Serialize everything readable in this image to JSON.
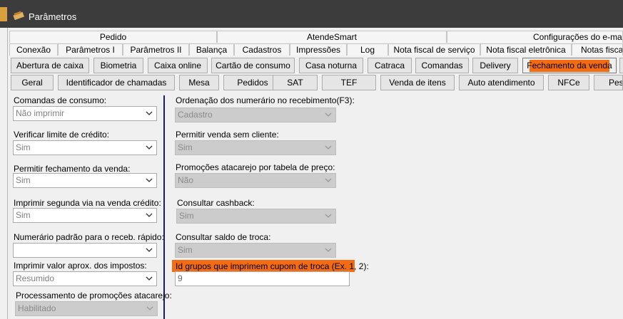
{
  "window": {
    "title": "Parâmetros"
  },
  "tabs_row1": [
    "Pedido",
    "AtendeSmart",
    "Configurações do e-mail"
  ],
  "tabs_row2": [
    "Conexão",
    "Parâmetros I",
    "Parâmetros II",
    "Balança",
    "Cadastros",
    "Impressões",
    "Log",
    "Nota fiscal de serviço",
    "Nota fiscal eletrônica",
    "Notas fiscais"
  ],
  "tabs_row3": [
    "Abertura de caixa",
    "Biometria",
    "Caixa online",
    "Cartão de consumo",
    "Casa noturna",
    "Catraca",
    "Comandas",
    "Delivery",
    "Fechamento da venda"
  ],
  "tabs_row4": [
    "Geral",
    "Identificador de chamadas",
    "Mesa",
    "Pedidos",
    "SAT",
    "TEF",
    "Venda de itens",
    "Auto atendimento",
    "NFCe",
    "Peso"
  ],
  "active_tab": "Fechamento da venda",
  "left": {
    "comandas_label": "Comandas de consumo:",
    "comandas_value": "Não imprimir",
    "limite_label": "Verificar limite de crédito:",
    "limite_value": "Sim",
    "fechamento_label": "Permitir fechamento da venda:",
    "fechamento_value": "Sim",
    "segunda_via_label": "Imprimir segunda via na venda crédito:",
    "segunda_via_value": "Sim",
    "numerario_label": "Numerário padrão para o receb. rápido:",
    "numerario_value": "",
    "impostos_label": "Imprimir valor aprox. dos impostos:",
    "impostos_value": "Resumido",
    "promocoes_label": "Processamento de promoções atacarejo:",
    "promocoes_value": "Habilitado"
  },
  "right": {
    "ordenacao_label": "Ordenação dos numerário no recebimento(F3):",
    "ordenacao_value": "Cadastro",
    "sem_cliente_label": "Permitir venda sem cliente:",
    "sem_cliente_value": "Sim",
    "promo_preco_label": "Promoções atacarejo por tabela de preço:",
    "promo_preco_value": "Não",
    "cashback_label": "Consultar cashback:",
    "cashback_value": "Sim",
    "saldo_troca_label": "Consultar saldo de troca:",
    "saldo_troca_value": "Sim",
    "id_grupos_label": "Id grupos que imprimem cupom de troca (Ex. 1, 2):",
    "id_grupos_value": "9"
  },
  "colors": {
    "highlight": "#f36b12",
    "titlebar": "#3c3c3c",
    "separator": "#1b1b7a"
  }
}
